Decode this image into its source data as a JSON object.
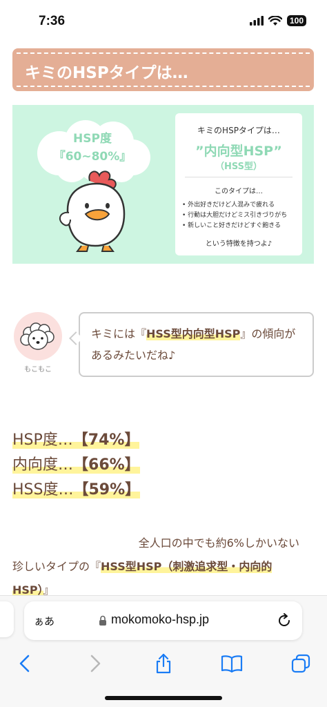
{
  "status": {
    "time": "7:36",
    "battery": "100"
  },
  "header": {
    "title": "キミのHSPタイプは…"
  },
  "result": {
    "cloud_line1": "HSP度",
    "cloud_line2": "『60~80%』",
    "box_title": "キミのHSPタイプは…",
    "box_type": "”内向型HSP”",
    "box_sub": "（HSS型）",
    "box_lead": "このタイプは…",
    "traits": [
      "外出好きだけど人混みで疲れる",
      "行動は大胆だけどミス引きづりがち",
      "新しいこと好きだけどすぐ飽きる"
    ],
    "box_foot": "という特徴を持つよ♪"
  },
  "speech": {
    "avatar_name": "もこもこ",
    "text_before": "キミには『",
    "text_highlight": "HSS型内向型HSP",
    "text_after": "』の傾向があるみたいだね♪"
  },
  "stats": [
    {
      "label": "HSP度…",
      "value": "【74%】"
    },
    {
      "label": "内向度…",
      "value": "【66%】"
    },
    {
      "label": "HSS度…",
      "value": "【59%】"
    }
  ],
  "paragraph": {
    "line1": "全人口の中でも約6%しかいない",
    "line2_before": "珍しいタイプの『",
    "line2_highlight": "HSS型HSP（刺激追求型・内向的HSP）",
    "line2_after": "』"
  },
  "browser": {
    "aa_label": "ぁあ",
    "url": "mokomoko-hsp.jp"
  },
  "colors": {
    "banner": "#e4ae95",
    "mint": "#cdf5e1",
    "accent_text": "#8fd9b5",
    "highlight": "#fff49b",
    "body_text": "#6b4a3a",
    "ios_blue": "#1a7cf5"
  }
}
